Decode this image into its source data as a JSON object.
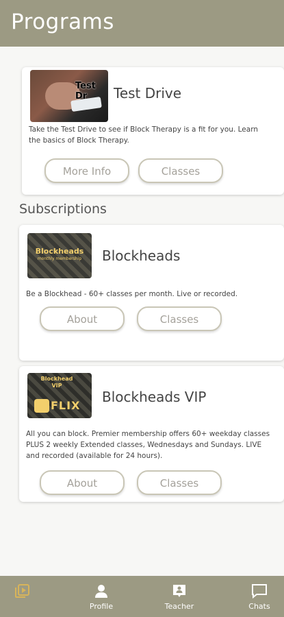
{
  "header": {
    "title": "Programs"
  },
  "test_drive": {
    "title": "Test Drive",
    "thumb_text": "Test Dr",
    "description": "Take the Test Drive to see if Block Therapy is a fit for you.  Learn the basics of Block Therapy.",
    "buttons": {
      "more_info": "More Info",
      "classes": "Classes"
    }
  },
  "subscriptions": {
    "label": "Subscriptions",
    "items": [
      {
        "title": "Blockheads",
        "thumb_text": "Blockheads",
        "thumb_subtext": "monthly membership",
        "description": "Be a Blockhead - 60+ classes per month.  Live or recorded.",
        "buttons": {
          "about": "About",
          "classes": "Classes"
        }
      },
      {
        "title": "Blockheads VIP",
        "thumb_text": "Blockhead VIP",
        "thumb_subtext": "FLIX",
        "description": "All you can block.  Premier membership offers 60+ weekday classes PLUS 2 weekly Extended classes, Wednesdays and Sundays.  LIVE and recorded (available for 24 hours).",
        "buttons": {
          "about": "About",
          "classes": "Classes"
        }
      }
    ]
  },
  "tabbar": {
    "items": [
      {
        "label": "",
        "icon": "video-library-icon",
        "active": true
      },
      {
        "label": "Profile",
        "icon": "person-icon"
      },
      {
        "label": "Teacher",
        "icon": "teacher-chat-icon"
      },
      {
        "label": "Chats",
        "icon": "chat-bubble-icon"
      }
    ]
  },
  "colors": {
    "accent": "#9c9a83",
    "active_tab": "#d8b45a",
    "button_border": "#c9c6b6"
  }
}
